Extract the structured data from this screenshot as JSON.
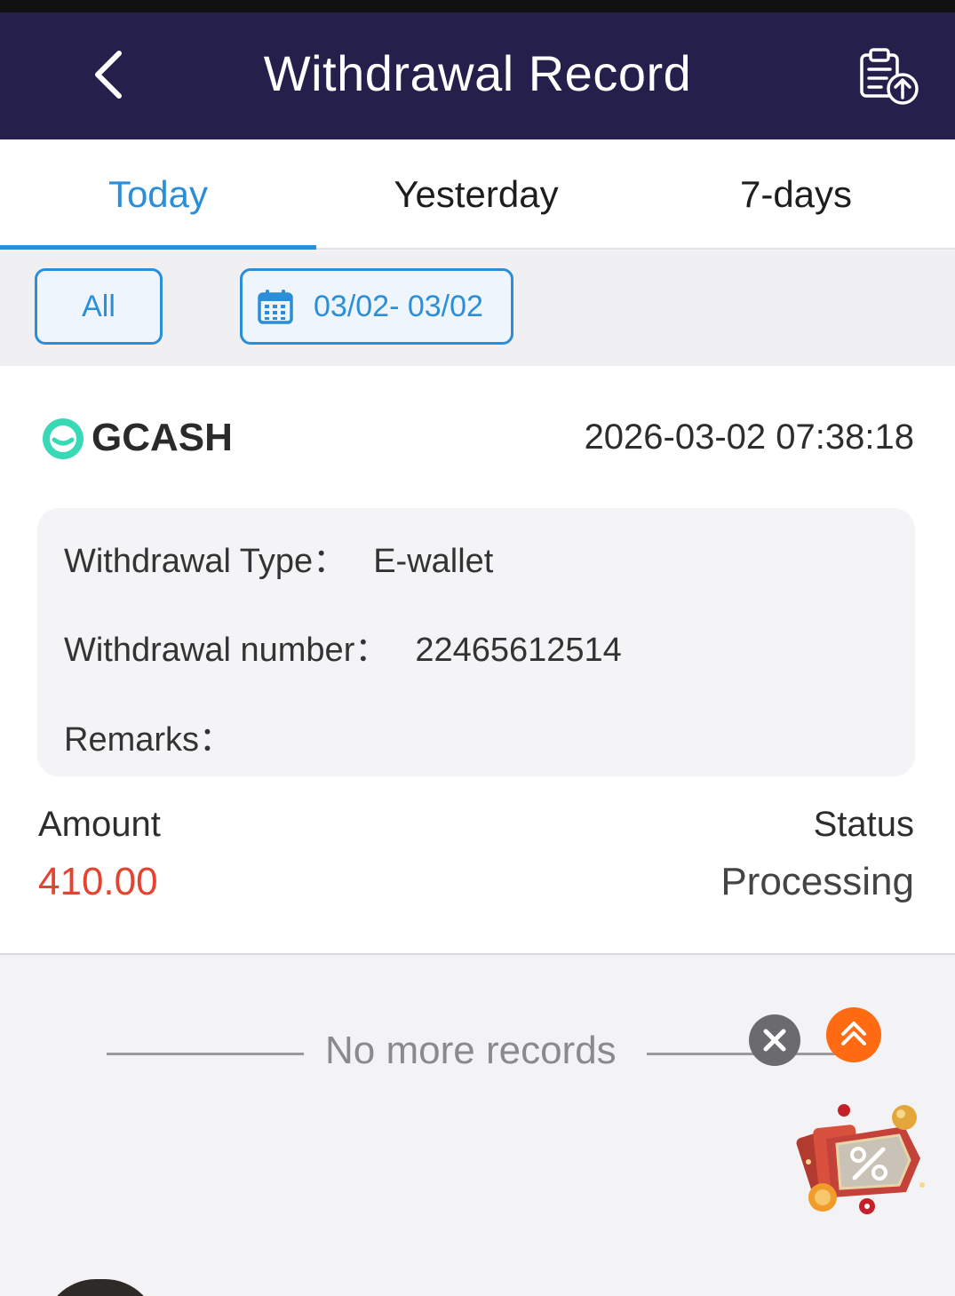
{
  "header": {
    "title": "Withdrawal Record",
    "back_icon": "chevron-left-icon",
    "records_icon": "clipboard-upload-icon",
    "background": "#241f4b"
  },
  "tabs": [
    {
      "label": "Today",
      "active": true
    },
    {
      "label": "Yesterday",
      "active": false
    },
    {
      "label": "7-days",
      "active": false
    }
  ],
  "filters": {
    "all_label": "All",
    "date_range": "03/02- 03/02",
    "date_icon": "calendar-icon",
    "accent": "#2a8fd8"
  },
  "record": {
    "method": "GCASH",
    "method_icon": "gcash-logo-icon",
    "datetime": "2026-03-02 07:38:18",
    "type_label": "Withdrawal Type：",
    "type_value": "E-wallet",
    "number_label": "Withdrawal number：",
    "number_value": "22465612514",
    "remarks_label": "Remarks：",
    "remarks_value": "",
    "amount_label": "Amount",
    "amount_value": "410.00",
    "amount_color": "#e5432f",
    "status_label": "Status",
    "status_value": "Processing"
  },
  "footer": {
    "no_more": "No more records",
    "close_icon": "close-icon",
    "back_to_top_icon": "double-chevron-up-icon",
    "promo_icon": "promo-percent-icon"
  }
}
